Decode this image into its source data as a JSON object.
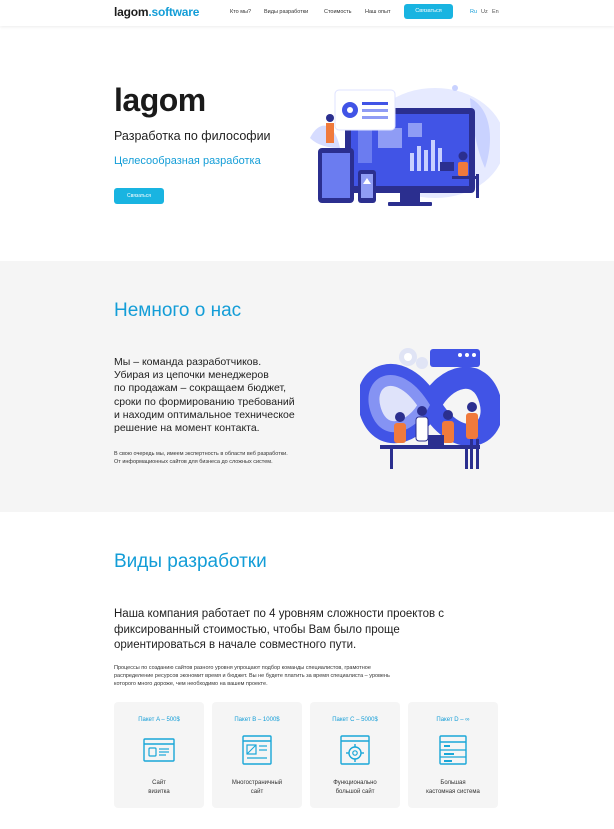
{
  "header": {
    "logo_main": "lagom",
    "logo_accent": ".software",
    "nav": [
      "Кто мы?",
      "Виды разработки",
      "Стоимость",
      "Наш опыт"
    ],
    "contact_label": "Связаться",
    "languages": [
      "Ru",
      "Uz",
      "En"
    ],
    "active_language": "Ru"
  },
  "hero": {
    "title": "lagom",
    "subtitle": "Разработка по философии",
    "accent": "Целесообразная разработка",
    "button_label": "Связаться"
  },
  "about": {
    "title": "Немного о нас",
    "lead_lines": [
      "Мы – команда разработчиков.",
      "Убирая из цепочки менеджеров",
      "по продажам – сокращаем бюджет,",
      "сроки по формированию требований",
      "и находим оптимальное техническое",
      "решение на момент контакта."
    ],
    "small_lines": [
      "В свою очередь мы, имеем экспертность в области веб разработки.",
      "От информационных сайтов для бизнеса до сложных систем."
    ]
  },
  "development": {
    "title": "Виды разработки",
    "lead_lines": [
      "Наша компания работает по 4 уровням сложности проектов с",
      "фиксированный стоимостью, чтобы Вам было проще",
      "ориентироваться в начале совместного пути."
    ],
    "small_lines": [
      "Процессы по созданию сайтов разного уровня упрощают подбор команды специалистов, грамотное",
      "распределение ресурсов экономит время и бюджет. Вы не будете платить за время специалиста – уровень",
      "которого много дороже, чем необходимо на вашем проекте."
    ],
    "packages": [
      {
        "title": "Пакет A – 500$",
        "label_lines": [
          "Сайт",
          "визитка"
        ],
        "icon": "business-card-site-icon"
      },
      {
        "title": "Пакет B – 1000$",
        "label_lines": [
          "Многостраничный",
          "сайт"
        ],
        "icon": "multipage-site-icon"
      },
      {
        "title": "Пакет C – 5000$",
        "label_lines": [
          "Функционально",
          "большой сайт"
        ],
        "icon": "functional-site-icon"
      },
      {
        "title": "Пакет D – ∞",
        "label_lines": [
          "Большая",
          "кастомная система"
        ],
        "icon": "custom-system-icon"
      }
    ]
  },
  "colors": {
    "accent": "#139dd7",
    "button": "#19b4e1",
    "section_bg": "#f5f5f5",
    "illustration_blue": "#3b4fe0",
    "illustration_orange": "#f07a3c"
  }
}
